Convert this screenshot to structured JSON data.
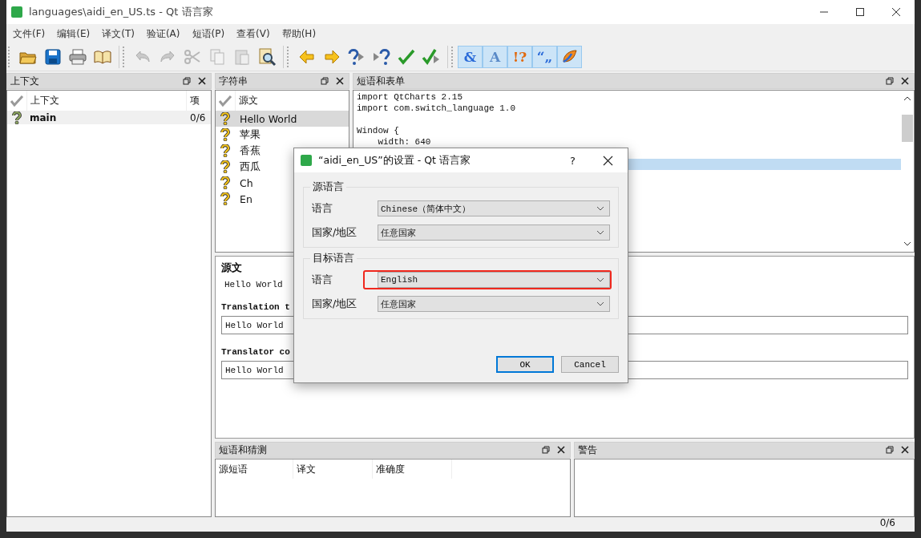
{
  "window": {
    "title": "languages\\aidi_en_US.ts - Qt 语言家"
  },
  "menu": [
    "文件(F)",
    "编辑(E)",
    "译文(T)",
    "验证(A)",
    "短语(P)",
    "查看(V)",
    "帮助(H)"
  ],
  "toolbar": {
    "groups": [
      [
        {
          "disabled": false
        },
        {
          "disabled": false
        },
        {
          "disabled": false
        },
        {
          "disabled": false
        }
      ],
      [
        {
          "disabled": true
        },
        {
          "disabled": true
        },
        {
          "disabled": true
        },
        {
          "disabled": true
        },
        {
          "disabled": true
        },
        {
          "disabled": false
        }
      ],
      [
        {
          "disabled": false
        },
        {
          "disabled": false
        },
        {
          "disabled": false
        },
        {
          "disabled": false
        },
        {
          "disabled": false
        },
        {
          "disabled": false
        }
      ],
      [
        {
          "glyph": "&",
          "checked": true
        },
        {
          "glyph": "A",
          "checked": true
        },
        {
          "glyph": "!?",
          "checked": true
        },
        {
          "glyph": "“„",
          "checked": true
        },
        {
          "checked": true
        }
      ]
    ]
  },
  "contexts_dock": {
    "title": "上下文",
    "columns": [
      "上下文",
      "项"
    ],
    "rows": [
      {
        "name": "main",
        "count": "0/6",
        "selected": true
      }
    ]
  },
  "strings_dock": {
    "title": "字符串",
    "columns": [
      "源文"
    ],
    "rows": [
      {
        "text": "Hello World",
        "selected": true
      },
      {
        "text": "苹果",
        "selected": false
      },
      {
        "text": "香蕉",
        "selected": false
      },
      {
        "text": "西瓜",
        "selected": false
      },
      {
        "text": "Ch",
        "selected": false
      },
      {
        "text": "En",
        "selected": false
      }
    ]
  },
  "phrases_dock": {
    "title": "短语和表单",
    "lines": [
      {
        "text": "import QtCharts 2.15",
        "selected": false
      },
      {
        "text": "import com.switch_language 1.0",
        "selected": false
      },
      {
        "selected": false
      },
      {
        "text": "Window {",
        "selected": false
      },
      {
        "text": "    width: 640",
        "selected": false
      },
      {
        "selected": false
      },
      {
        "selected": true
      }
    ]
  },
  "editor": {
    "source_label": "源文",
    "source_text": "Hello World",
    "translation_label": "Translation t",
    "translation_value": "Hello World",
    "comment_label": "Translator co",
    "comment_value": "Hello World"
  },
  "guesses_dock": {
    "title": "短语和猜测",
    "columns": [
      "源短语",
      "译文",
      "准确度"
    ]
  },
  "warnings_dock": {
    "title": "警告"
  },
  "status_bar": {
    "count": "0/6"
  },
  "dialog": {
    "title": "“aidi_en_US”的设置 - Qt 语言家",
    "help": "?",
    "groups": [
      {
        "title": "源语言",
        "rows": [
          {
            "label": "语言",
            "value": "Chinese（简体中文）",
            "highlighted": false
          },
          {
            "label": "国家/地区",
            "value": "任意国家",
            "highlighted": false
          }
        ]
      },
      {
        "title": "目标语言",
        "rows": [
          {
            "label": "语言",
            "value": "English",
            "highlighted": true
          },
          {
            "label": "国家/地区",
            "value": "任意国家",
            "highlighted": false
          }
        ]
      }
    ],
    "buttons": [
      {
        "label": "OK",
        "default": true
      },
      {
        "label": "Cancel",
        "default": false
      }
    ]
  }
}
